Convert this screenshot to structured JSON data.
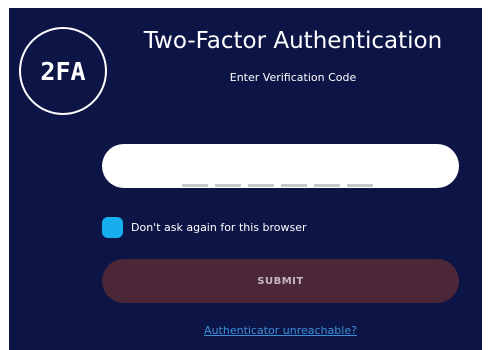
{
  "logo": {
    "text": "2FA"
  },
  "header": {
    "title": "Two-Factor Authentication",
    "subtitle": "Enter Verification Code"
  },
  "code_input": {
    "slot_count": 6,
    "value": ""
  },
  "remember": {
    "label": "Don't ask again for this browser",
    "checked": true
  },
  "submit": {
    "label": "SUBMIT"
  },
  "help": {
    "link_text": "Authenticator unreachable?"
  },
  "colors": {
    "panel_bg": "#0d1547",
    "checkbox": "#17aef0",
    "submit_bg": "#4b2737",
    "link": "#3b8fd9"
  }
}
